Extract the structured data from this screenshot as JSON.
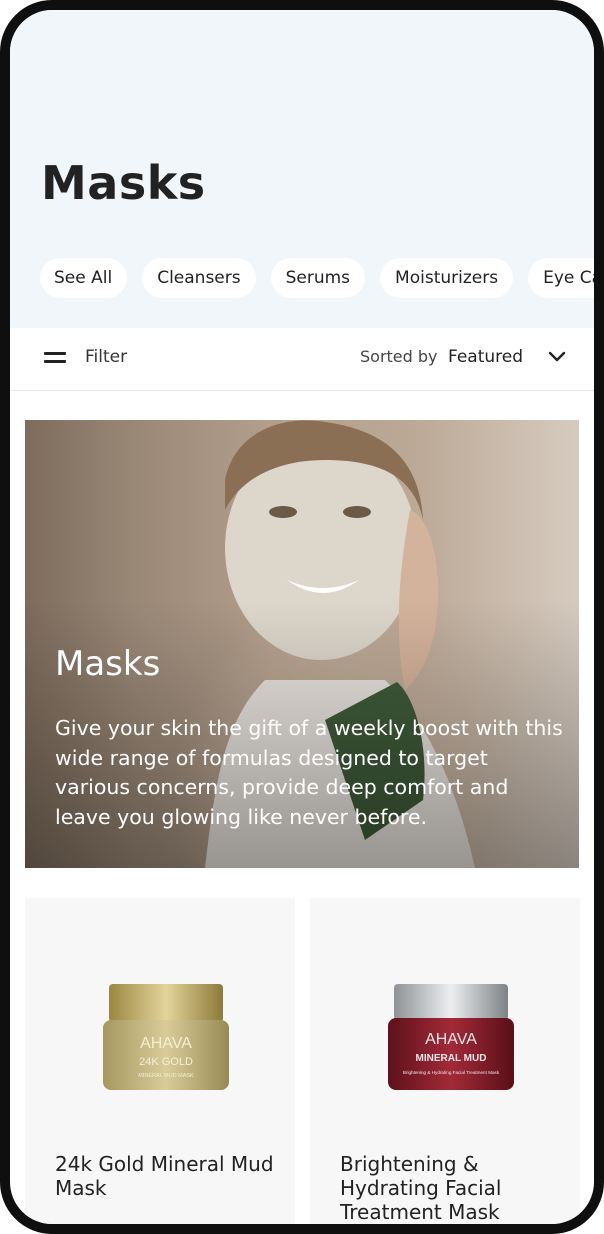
{
  "page": {
    "title": "Masks"
  },
  "categories": [
    "See All",
    "Cleansers",
    "Serums",
    "Moisturizers",
    "Eye Care"
  ],
  "toolbar": {
    "filter_label": "Filter",
    "sort_prefix": "Sorted by",
    "sort_value": "Featured",
    "filter_icon": "filter-lines-icon",
    "sort_icon": "chevron-down-icon"
  },
  "hero": {
    "title": "Masks",
    "description": "Give your skin the gift of a weekly boost with this wide range of formulas designed to target various concerns, provide deep comfort and leave you glowing like never before."
  },
  "products": [
    {
      "name": "24k Gold Mineral Mud Mask",
      "brand_label": "AHAVA",
      "jar_line1": "24K GOLD",
      "jar_line2": "MINERAL MUD MASK",
      "jar_color": "#c5b27a"
    },
    {
      "name": "Brightening & Hydrating Facial Treatment Mask",
      "brand_label": "AHAVA",
      "jar_line1": "MINERAL MUD",
      "jar_line2": "Brightening & Hydrating Facial Treatment Mask",
      "jar_color": "#8a1f2c"
    }
  ],
  "colors": {
    "header_bg": "#f0f6fa",
    "chip_bg": "#ffffff",
    "text": "#222222"
  }
}
